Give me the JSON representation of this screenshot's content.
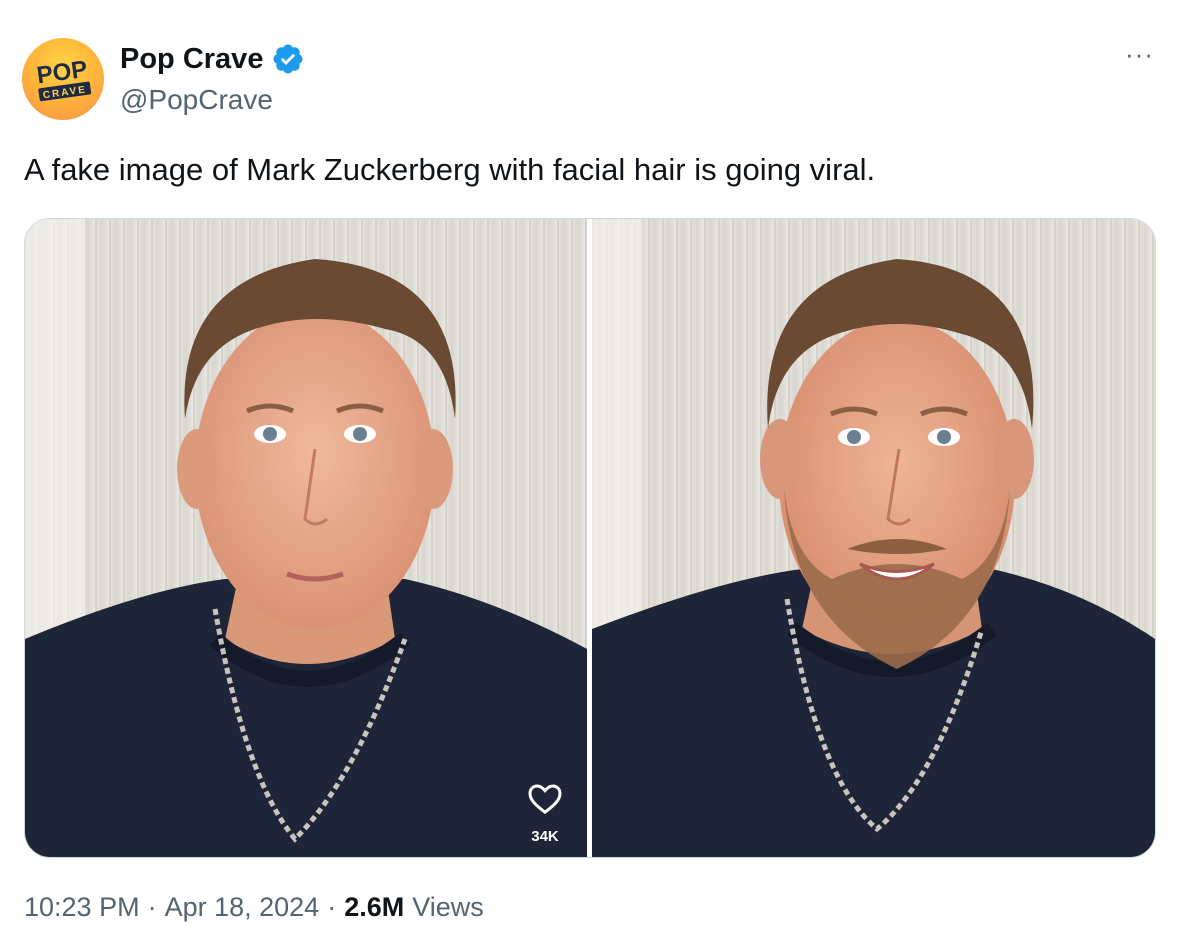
{
  "tweet": {
    "display_name": "Pop Crave",
    "handle": "@PopCrave",
    "avatar_text_top": "POP",
    "avatar_text_bottom": "CRAVE",
    "verified_icon": "verified-badge-icon",
    "more_icon": "more-horizontal-icon",
    "more_label": "···",
    "text": "A fake image of Mark Zuckerberg with facial hair is going viral.",
    "media": {
      "left_overlay_icon": "heart-outline-icon",
      "left_overlay_count": "34K"
    },
    "time": "10:23 PM",
    "date": "Apr 18, 2024",
    "views_count": "2.6M",
    "views_label": "Views",
    "separator": "·"
  },
  "colors": {
    "text": "#0f1419",
    "secondary": "#536471",
    "verified": "#1d9bf0",
    "avatar_bg": "#ffb83a",
    "media_border": "#cfd9de"
  }
}
